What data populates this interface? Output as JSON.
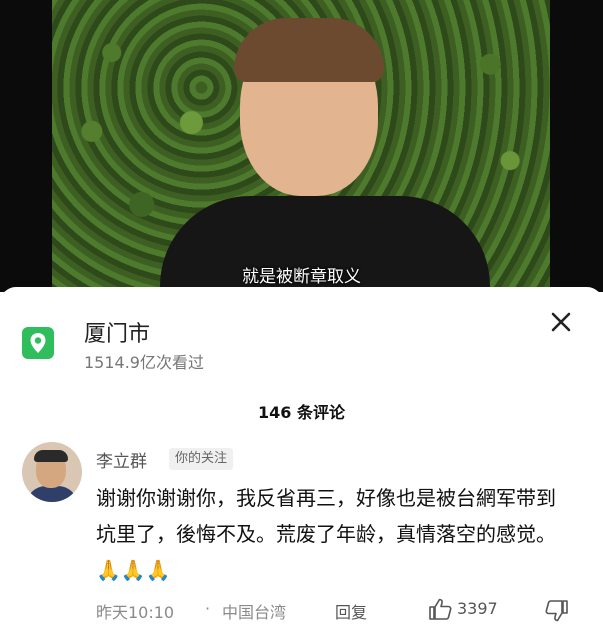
{
  "video": {
    "subtitle": "就是被断章取义"
  },
  "location": {
    "icon": "location-pin-icon",
    "icon_color": "#2fbe5b",
    "name": "厦门市",
    "views": "1514.9亿次看过"
  },
  "close_icon": "close-icon",
  "comments": {
    "count_label": "146 条评论",
    "items": [
      {
        "author": "李立群",
        "tag": "你的关注",
        "text": "谢谢你谢谢你，我反省再三，好像也是被台網军带到坑里了，後悔不及。荒废了年龄，真情落空的感觉。",
        "emojis": "🙏🙏🙏",
        "time": "昨天10:10",
        "separator": "·",
        "region": "中国台湾",
        "reply_label": "回复",
        "likes": "3397"
      }
    ]
  }
}
